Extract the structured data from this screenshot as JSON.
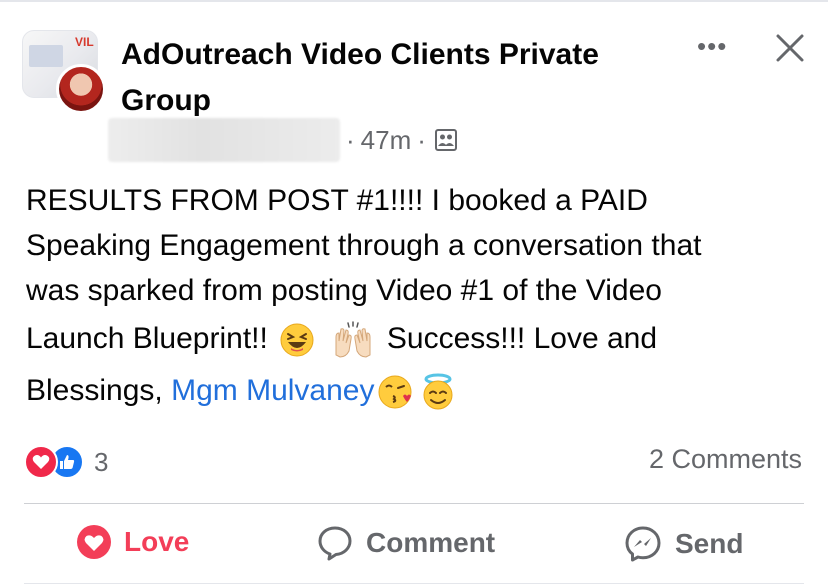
{
  "post": {
    "group_name": "AdOutreach Video Clients Private Group",
    "avatar_badge": "VIL",
    "time": "47m",
    "separator": "·",
    "text_line1": "RESULTS FROM POST #1!!!!  I booked a PAID",
    "text_line2": "Speaking Engagement through a conversation that",
    "text_line3": "was sparked from posting Video #1 of the Video",
    "text_line4a": "Launch Blueprint!!",
    "text_line4b": "Success!!! Love and",
    "text_line5a": "Blessings, ",
    "mention": "Mgm Mulvaney",
    "emojis": [
      "laughing-face",
      "raising-hands",
      "kissing-heart-face",
      "halo-face"
    ]
  },
  "reactions": {
    "count": "3",
    "types": [
      "love",
      "like"
    ]
  },
  "comments_label": "2 Comments",
  "actions": {
    "love": "Love",
    "comment": "Comment",
    "send": "Send"
  },
  "colors": {
    "love": "#f33e58",
    "like": "#1877f2",
    "mention": "#216fdb",
    "secondary": "#65676b"
  }
}
